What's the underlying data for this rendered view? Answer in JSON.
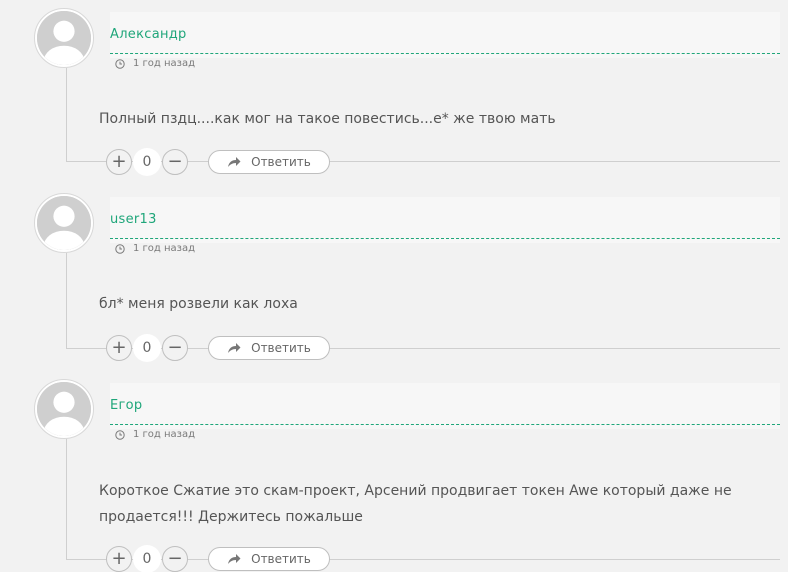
{
  "comments": [
    {
      "author": "Александр",
      "time": "1 год назад",
      "text": "Полный пздц....как мог на такое повестись...е* же твою мать",
      "votes": "0",
      "reply_label": "Ответить"
    },
    {
      "author": "user13",
      "time": "1 год назад",
      "text": "бл* меня розвели как лоха",
      "votes": "0",
      "reply_label": "Ответить"
    },
    {
      "author": "Егор",
      "time": "1 год назад",
      "text": "Короткое Сжатие это скам-проект, Арсений продвигает токен Awe который даже не продается!!! Держитесь пожальше",
      "votes": "0",
      "reply_label": "Ответить"
    }
  ],
  "icons": {
    "avatar": "default-user-avatar-icon",
    "time": "clock-icon",
    "upvote": "plus-icon",
    "downvote": "minus-icon",
    "reply": "reply-arrow-icon"
  },
  "colors": {
    "accent": "#1fa67a",
    "background": "#f2f2f2",
    "text": "#555555"
  }
}
